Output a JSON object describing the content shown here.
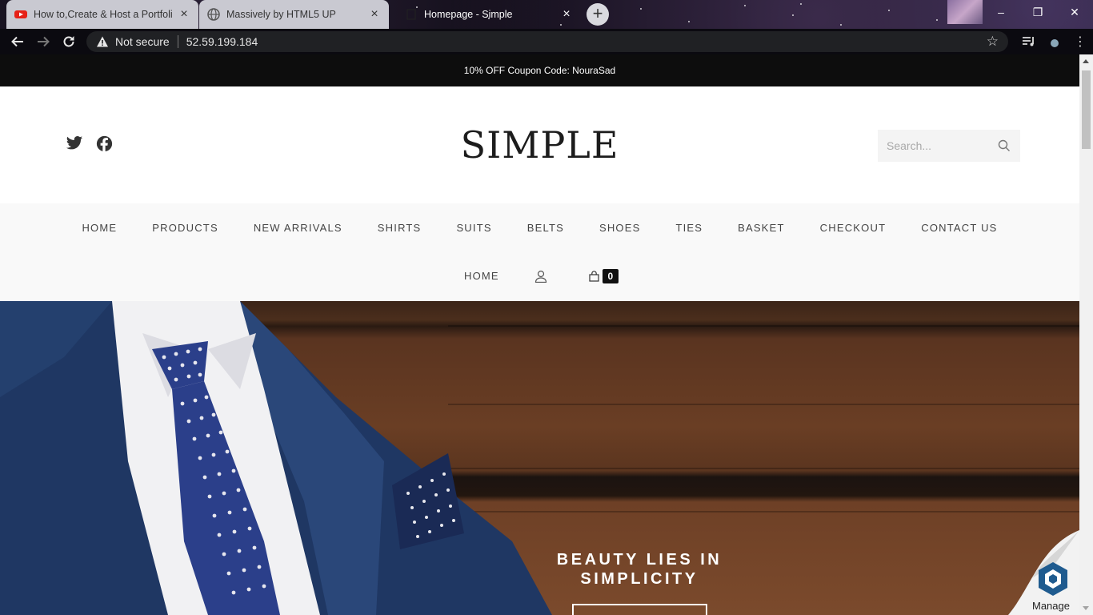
{
  "browser": {
    "tabs": [
      {
        "title": "How to,Create & Host a Portfolio",
        "state": "inactive",
        "icon": "youtube-icon"
      },
      {
        "title": "Massively by HTML5 UP",
        "state": "inactive",
        "icon": "globe-icon"
      },
      {
        "title": "Homepage - Simple",
        "state": "active",
        "icon": "page-icon"
      }
    ],
    "address": {
      "security_label": "Not secure",
      "url": "52.59.199.184"
    }
  },
  "page": {
    "coupon_text": "10% OFF Coupon Code: NouraSad",
    "logo": "SIMPLE",
    "search": {
      "placeholder": "Search..."
    },
    "nav": {
      "row1": [
        "HOME",
        "PRODUCTS",
        "NEW ARRIVALS",
        "SHIRTS",
        "SUITS",
        "BELTS",
        "SHOES",
        "TIES",
        "BASKET",
        "CHECKOUT",
        "CONTACT US"
      ],
      "row2_home": "HOME",
      "cart_count": "0"
    },
    "hero": {
      "title_line1": "BEAUTY LIES IN",
      "title_line2": "SIMPLICITY"
    },
    "manage_label": "Manage"
  },
  "colors": {
    "coupon_bar": "#0d0d0d",
    "nav_background": "#f9f9f9",
    "nav_text": "#444444"
  }
}
